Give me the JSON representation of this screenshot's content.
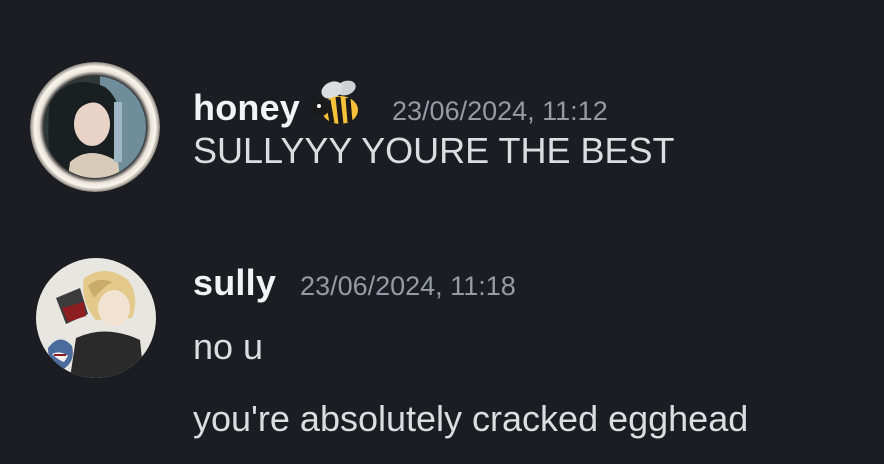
{
  "messages": [
    {
      "username": "honey",
      "badge_icon": "bee-emoji",
      "timestamp": "23/06/2024, 11:12",
      "lines": [
        "SULLYYY YOURE THE BEST"
      ]
    },
    {
      "username": "sully",
      "timestamp": "23/06/2024, 11:18",
      "lines": [
        "no u",
        "you're absolutely cracked egghead"
      ]
    }
  ],
  "colors": {
    "background": "#1c1d22",
    "username": "#f2f3f5",
    "timestamp": "#949ba4",
    "message_text": "#dbdee1"
  }
}
